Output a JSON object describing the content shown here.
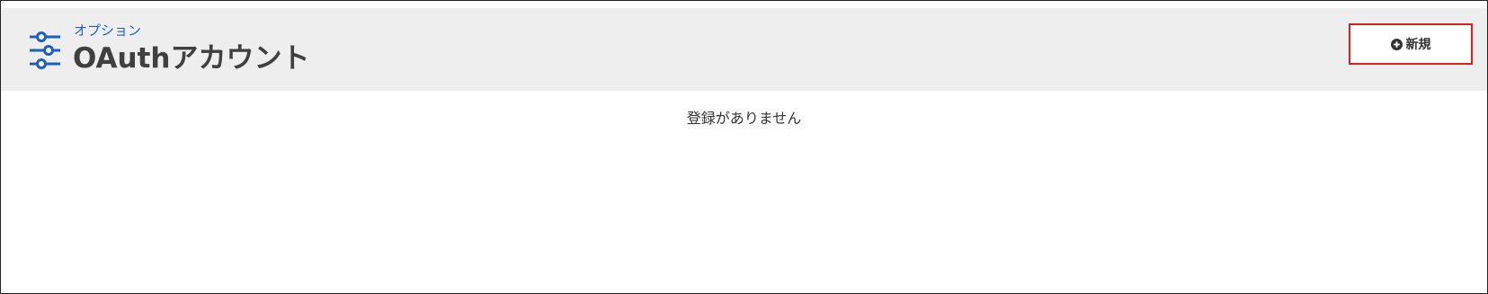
{
  "header": {
    "breadcrumb": "オプション",
    "title": "OAuthアカウント",
    "icon": "settings-sliders-icon",
    "new_button": {
      "label": "新規",
      "icon": "plus-circle-icon"
    }
  },
  "main": {
    "empty_message": "登録がありません"
  },
  "colors": {
    "accent": "#1d5fbf",
    "highlight_border": "#e01e1e",
    "header_bg": "#eeeeee"
  }
}
